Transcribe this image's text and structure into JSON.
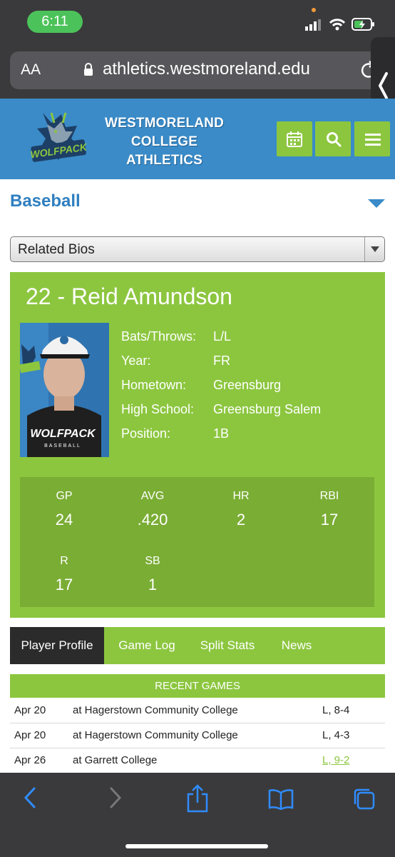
{
  "status": {
    "time": "6:11"
  },
  "browser": {
    "text_size_label": "AA",
    "url": "athletics.westmoreland.edu"
  },
  "site": {
    "title_lines": [
      "WESTMORELAND",
      "COLLEGE",
      "ATHLETICS"
    ],
    "logo_text": "WOLFPACK",
    "header_buttons": [
      "calendar-icon",
      "search-icon",
      "menu-icon"
    ],
    "colors": {
      "header_blue": "#3a8bc8",
      "accent_green": "#8cc63f",
      "dark_green": "#7aad34"
    }
  },
  "sport": {
    "title": "Baseball"
  },
  "related_select": {
    "selected": "Related Bios"
  },
  "player": {
    "heading": "22 - Reid Amundson",
    "photo_text": "WOLFPACK",
    "photo_subtext": "BASEBALL",
    "info": [
      {
        "label": "Bats/Throws:",
        "value": "L/L"
      },
      {
        "label": "Year:",
        "value": "FR"
      },
      {
        "label": "Hometown:",
        "value": "Greensburg"
      },
      {
        "label": "High School:",
        "value": "Greensburg Salem"
      },
      {
        "label": "Position:",
        "value": "1B"
      }
    ],
    "stats": [
      {
        "label": "GP",
        "value": "24"
      },
      {
        "label": "AVG",
        "value": ".420"
      },
      {
        "label": "HR",
        "value": "2"
      },
      {
        "label": "RBI",
        "value": "17"
      },
      {
        "label": "R",
        "value": "17"
      },
      {
        "label": "SB",
        "value": "1"
      }
    ]
  },
  "tabs": [
    {
      "label": "Player Profile",
      "active": true
    },
    {
      "label": "Game Log",
      "active": false
    },
    {
      "label": "Split Stats",
      "active": false
    },
    {
      "label": "News",
      "active": false
    }
  ],
  "recent_games": {
    "header": "RECENT GAMES",
    "rows": [
      {
        "date": "Apr 20",
        "opponent": "at Hagerstown Community College",
        "result": "L, 8-4",
        "link": false
      },
      {
        "date": "Apr 20",
        "opponent": "at Hagerstown Community College",
        "result": "L, 4-3",
        "link": false
      },
      {
        "date": "Apr 26",
        "opponent": "at Garrett College",
        "result": "L, 9-2",
        "link": true
      }
    ]
  },
  "toolbar": [
    "back-icon",
    "forward-icon",
    "share-icon",
    "bookmarks-icon",
    "tabs-icon"
  ]
}
